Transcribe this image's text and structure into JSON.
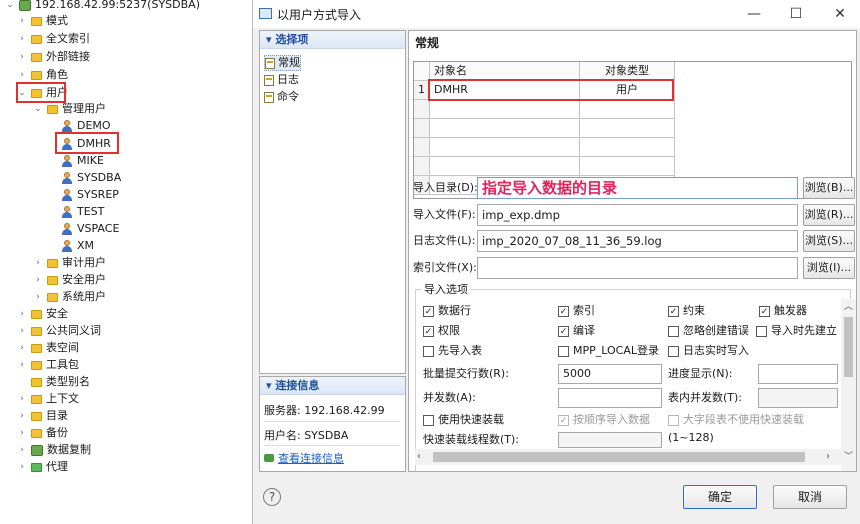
{
  "tree": {
    "root": "192.168.42.99:5237(SYSDBA)",
    "items": [
      "模式",
      "全文索引",
      "外部链接",
      "角色",
      "用户"
    ],
    "user_group": "管理用户",
    "users": [
      "DEMO",
      "DMHR",
      "MIKE",
      "SYSDBA",
      "SYSREP",
      "TEST",
      "VSPACE",
      "XM"
    ],
    "user_groups": [
      "审计用户",
      "安全用户",
      "系统用户"
    ],
    "more": [
      "安全",
      "公共同义词",
      "表空间",
      "工具包",
      "类型别名",
      "上下文",
      "目录",
      "备份",
      "数据复制",
      "代理"
    ]
  },
  "dialog": {
    "title": "以用户方式导入",
    "minimize": "—",
    "maximize": "☐",
    "close": "✕",
    "section_title": "常规",
    "nav_header": "选择项",
    "nav": [
      "常规",
      "日志",
      "命令"
    ],
    "conn_header": "连接信息",
    "conn_server": "服务器: 192.168.42.99",
    "conn_user": "用户名: SYSDBA",
    "conn_link": "查看连接信息",
    "grid": {
      "headers": [
        "对象名",
        "对象类型"
      ],
      "rows": [
        {
          "num": "1",
          "name": "DMHR",
          "type": "用户"
        }
      ]
    },
    "fields": {
      "dir_label": "导入目录(D):",
      "dir_value": "指定导入数据的目录",
      "file_label": "导入文件(F):",
      "file_value": "imp_exp.dmp",
      "log_label": "日志文件(L):",
      "log_value": "imp_2020_07_08_11_36_59.log",
      "index_label": "索引文件(X):",
      "index_value": "",
      "browse_b": "浏览(B)...",
      "browse_r": "浏览(R)...",
      "browse_s": "浏览(S)...",
      "browse_i": "浏览(I)..."
    },
    "options": {
      "legend": "导入选项",
      "rows": "数据行",
      "index": "索引",
      "constraint": "约束",
      "trigger": "触发器",
      "grant": "权限",
      "compile": "编译",
      "ignore_err": "忽略创建错误",
      "import_first": "导入时先建立",
      "table_first": "先导入表",
      "mpp_local": "MPP_LOCAL登录",
      "log_realtime": "日志实时写入",
      "batch_label": "批量提交行数(R):",
      "batch_value": "5000",
      "progress_label": "进度显示(N):",
      "parallel_label": "并发数(A):",
      "table_parallel_label": "表内并发数(T):",
      "fast_load": "使用快速装载",
      "order_import": "按顺序导入数据",
      "big_field": "大字段表不使用快速装载",
      "fast_threads_label": "快速装载线程数(T):",
      "range_hint": "(1~128)"
    },
    "buttons": {
      "ok": "确定",
      "cancel": "取消",
      "help": "?"
    }
  }
}
